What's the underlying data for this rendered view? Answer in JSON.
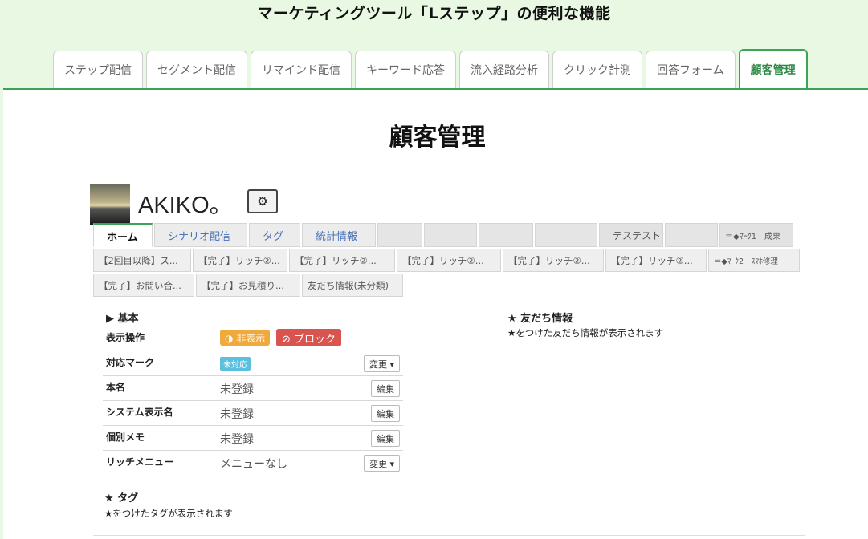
{
  "header": {
    "title": "マーケティングツール「Lステップ」の便利な機能"
  },
  "tabs": [
    {
      "label": "ステップ配信",
      "active": false
    },
    {
      "label": "セグメント配信",
      "active": false
    },
    {
      "label": "リマインド配信",
      "active": false
    },
    {
      "label": "キーワード応答",
      "active": false
    },
    {
      "label": "流入経路分析",
      "active": false
    },
    {
      "label": "クリック計測",
      "active": false
    },
    {
      "label": "回答フォーム",
      "active": false
    },
    {
      "label": "顧客管理",
      "active": true
    }
  ],
  "section": {
    "title": "顧客管理"
  },
  "profile": {
    "name": "AKIKO。",
    "settings_icon": "gear-icon"
  },
  "row1": {
    "home": "ホーム",
    "scenario": "シナリオ配信",
    "tag": "タグ",
    "stats": "統計情報",
    "test": "テステスト",
    "mark1": "＝◆ﾏｰｸ1　成果"
  },
  "row2": [
    "【2回目以降】ス...",
    "【完了】リッチ②...",
    "【完了】リッチ②...",
    "【完了】リッチ②...",
    "【完了】リッチ②...",
    "【完了】リッチ②...",
    "＝◆ﾏｰｸ2　ｽﾏﾎ修理"
  ],
  "row3": [
    "【完了】お問い合...",
    "【完了】お見積り...",
    "友だち情報(未分類)"
  ],
  "basic": {
    "title": "▶ 基本",
    "rows": {
      "display_op": "表示操作",
      "hide_badge": "◑ 非表示",
      "block_badge": "⊘ ブロック",
      "mark": "対応マーク",
      "mark_status": "未対応",
      "change": "変更 ▾",
      "real_name": "本名",
      "unregistered": "未登録",
      "edit": "編集",
      "system_name": "システム表示名",
      "memo": "個別メモ",
      "rich_menu": "リッチメニュー",
      "rich_menu_value": "メニューなし"
    }
  },
  "friend_info": {
    "title": "★ 友だち情報",
    "note": "★をつけた友だち情報が表示されます"
  },
  "tag_section": {
    "title": "★ タグ",
    "note": "★をつけたタグが表示されます"
  },
  "colors": {
    "accent": "#3aa655",
    "background": "#e8f8e2",
    "warning": "#f0a93b",
    "danger": "#d9534f",
    "info": "#5bc0de"
  }
}
